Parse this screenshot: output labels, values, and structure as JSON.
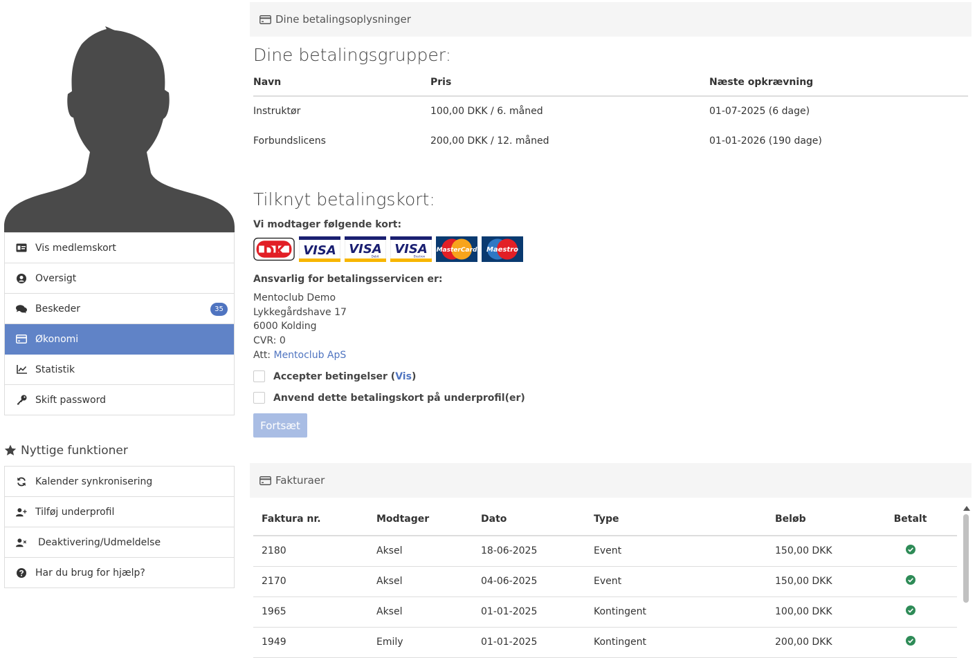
{
  "sidebar": {
    "menu": [
      {
        "label": "Vis medlemskort",
        "icon": "id-card-icon"
      },
      {
        "label": "Oversigt",
        "icon": "user-circle-icon"
      },
      {
        "label": "Beskeder",
        "icon": "comments-icon",
        "badge": "35"
      },
      {
        "label": "Økonomi",
        "icon": "credit-card-icon",
        "active": true
      },
      {
        "label": "Statistik",
        "icon": "line-chart-icon"
      },
      {
        "label": "Skift password",
        "icon": "key-icon"
      }
    ],
    "useful_title": "Nyttige funktioner",
    "useful": [
      {
        "label": "Kalender synkronisering",
        "icon": "sync-icon"
      },
      {
        "label": "Tilføj underprofil",
        "icon": "user-plus-icon"
      },
      {
        "label": "Deaktivering/Udmeldelse",
        "icon": "user-times-icon"
      },
      {
        "label": "Har du brug for hjælp?",
        "icon": "question-circle-icon"
      }
    ]
  },
  "payment_panel": {
    "title": "Dine betalingsoplysninger",
    "groups_heading": "Dine betalingsgrupper:",
    "groups_columns": [
      "Navn",
      "Pris",
      "Næste opkrævning"
    ],
    "groups": [
      {
        "name": "Instruktør",
        "price": "100,00 DKK / 6. måned",
        "next": "01-07-2025 (6 dage)"
      },
      {
        "name": "Forbundslicens",
        "price": "200,00 DKK / 12. måned",
        "next": "01-01-2026 (190 dage)"
      }
    ],
    "card_heading": "Tilknyt betalingskort:",
    "accepted_label": "Vi modtager følgende kort:",
    "cards": [
      {
        "name": "dankort-logo",
        "text": "DK"
      },
      {
        "name": "visa-logo",
        "text": "VISA"
      },
      {
        "name": "visa-debit-logo",
        "text": "VISA",
        "sub": "Debit"
      },
      {
        "name": "visa-electron-logo",
        "text": "VISA",
        "sub": "Electron"
      },
      {
        "name": "mastercard-logo",
        "text": "MasterCard"
      },
      {
        "name": "maestro-logo",
        "text": "Maestro"
      }
    ],
    "responsible_label": "Ansvarlig for betalingsservicen er:",
    "address": {
      "company": "Mentoclub Demo",
      "street": "Lykkegårdshave 17",
      "city": "6000 Kolding",
      "cvr": "CVR: 0",
      "att_prefix": "Att: ",
      "att_link": "Mentoclub ApS"
    },
    "accept_terms": {
      "label": "Accepter betingelser (",
      "link": "Vis",
      "suffix": ")"
    },
    "apply_subprofile": "Anvend dette betalingskort på underprofil(er)",
    "continue_button": "Fortsæt"
  },
  "invoices_panel": {
    "title": "Fakturaer",
    "columns": [
      "Faktura nr.",
      "Modtager",
      "Dato",
      "Type",
      "Beløb",
      "Betalt"
    ],
    "rows": [
      {
        "nr": "2180",
        "recipient": "Aksel",
        "date": "18-06-2025",
        "type": "Event",
        "amount": "150,00 DKK",
        "paid": true
      },
      {
        "nr": "2170",
        "recipient": "Aksel",
        "date": "04-06-2025",
        "type": "Event",
        "amount": "150,00 DKK",
        "paid": true
      },
      {
        "nr": "1965",
        "recipient": "Aksel",
        "date": "01-01-2025",
        "type": "Kontingent",
        "amount": "100,00 DKK",
        "paid": true
      },
      {
        "nr": "1949",
        "recipient": "Emily",
        "date": "01-01-2025",
        "type": "Kontingent",
        "amount": "200,00 DKK",
        "paid": true
      }
    ]
  },
  "colors": {
    "accent": "#6083c7",
    "badge": "#4f74c0",
    "link": "#4f74c0",
    "paid": "#2e8b57",
    "button_disabled": "#a9bde4"
  }
}
